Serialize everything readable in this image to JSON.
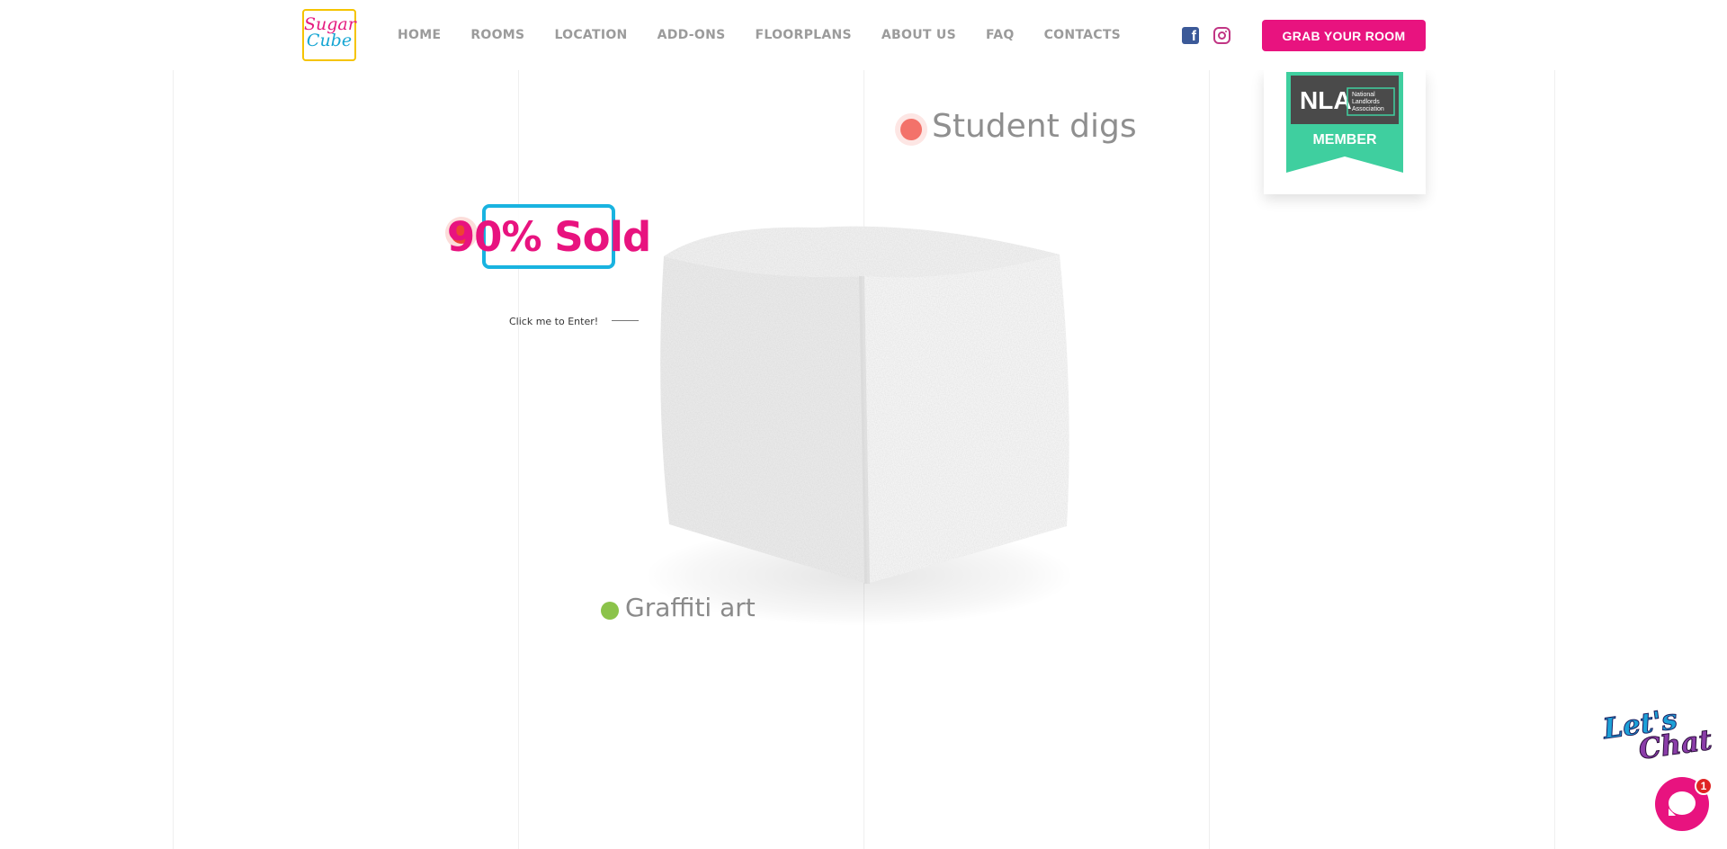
{
  "brand": {
    "logo_line1": "Sugar",
    "logo_line2": "Cube"
  },
  "nav": {
    "items": [
      "HOME",
      "ROOMS",
      "LOCATION",
      "ADD-ONS",
      "FLOORPLANS",
      "ABOUT US",
      "FAQ",
      "CONTACTS"
    ],
    "cta_label": "GRAB YOUR ROOM"
  },
  "social": {
    "facebook_icon": "facebook-icon",
    "instagram_icon": "instagram-icon"
  },
  "badge": {
    "org_short": "NLA",
    "org_full_line1": "National",
    "org_full_line2": "Landlords",
    "org_full_line3": "Association",
    "member_label": "MEMBER"
  },
  "hero": {
    "sold_label": "90% Sold",
    "enter_label": "Click me to Enter!",
    "feature_student": "Student digs",
    "feature_graffiti": "Graffiti art"
  },
  "chat": {
    "script_line1": "Let's",
    "script_line2": "Chat",
    "unread_count": "1"
  },
  "colors": {
    "brand_pink": "#e8137f",
    "brand_blue": "#19b3e0",
    "badge_green": "#3fcf9f",
    "dot_red": "#ee4433",
    "dot_coral": "#f3726a",
    "dot_green": "#8bc34a"
  }
}
